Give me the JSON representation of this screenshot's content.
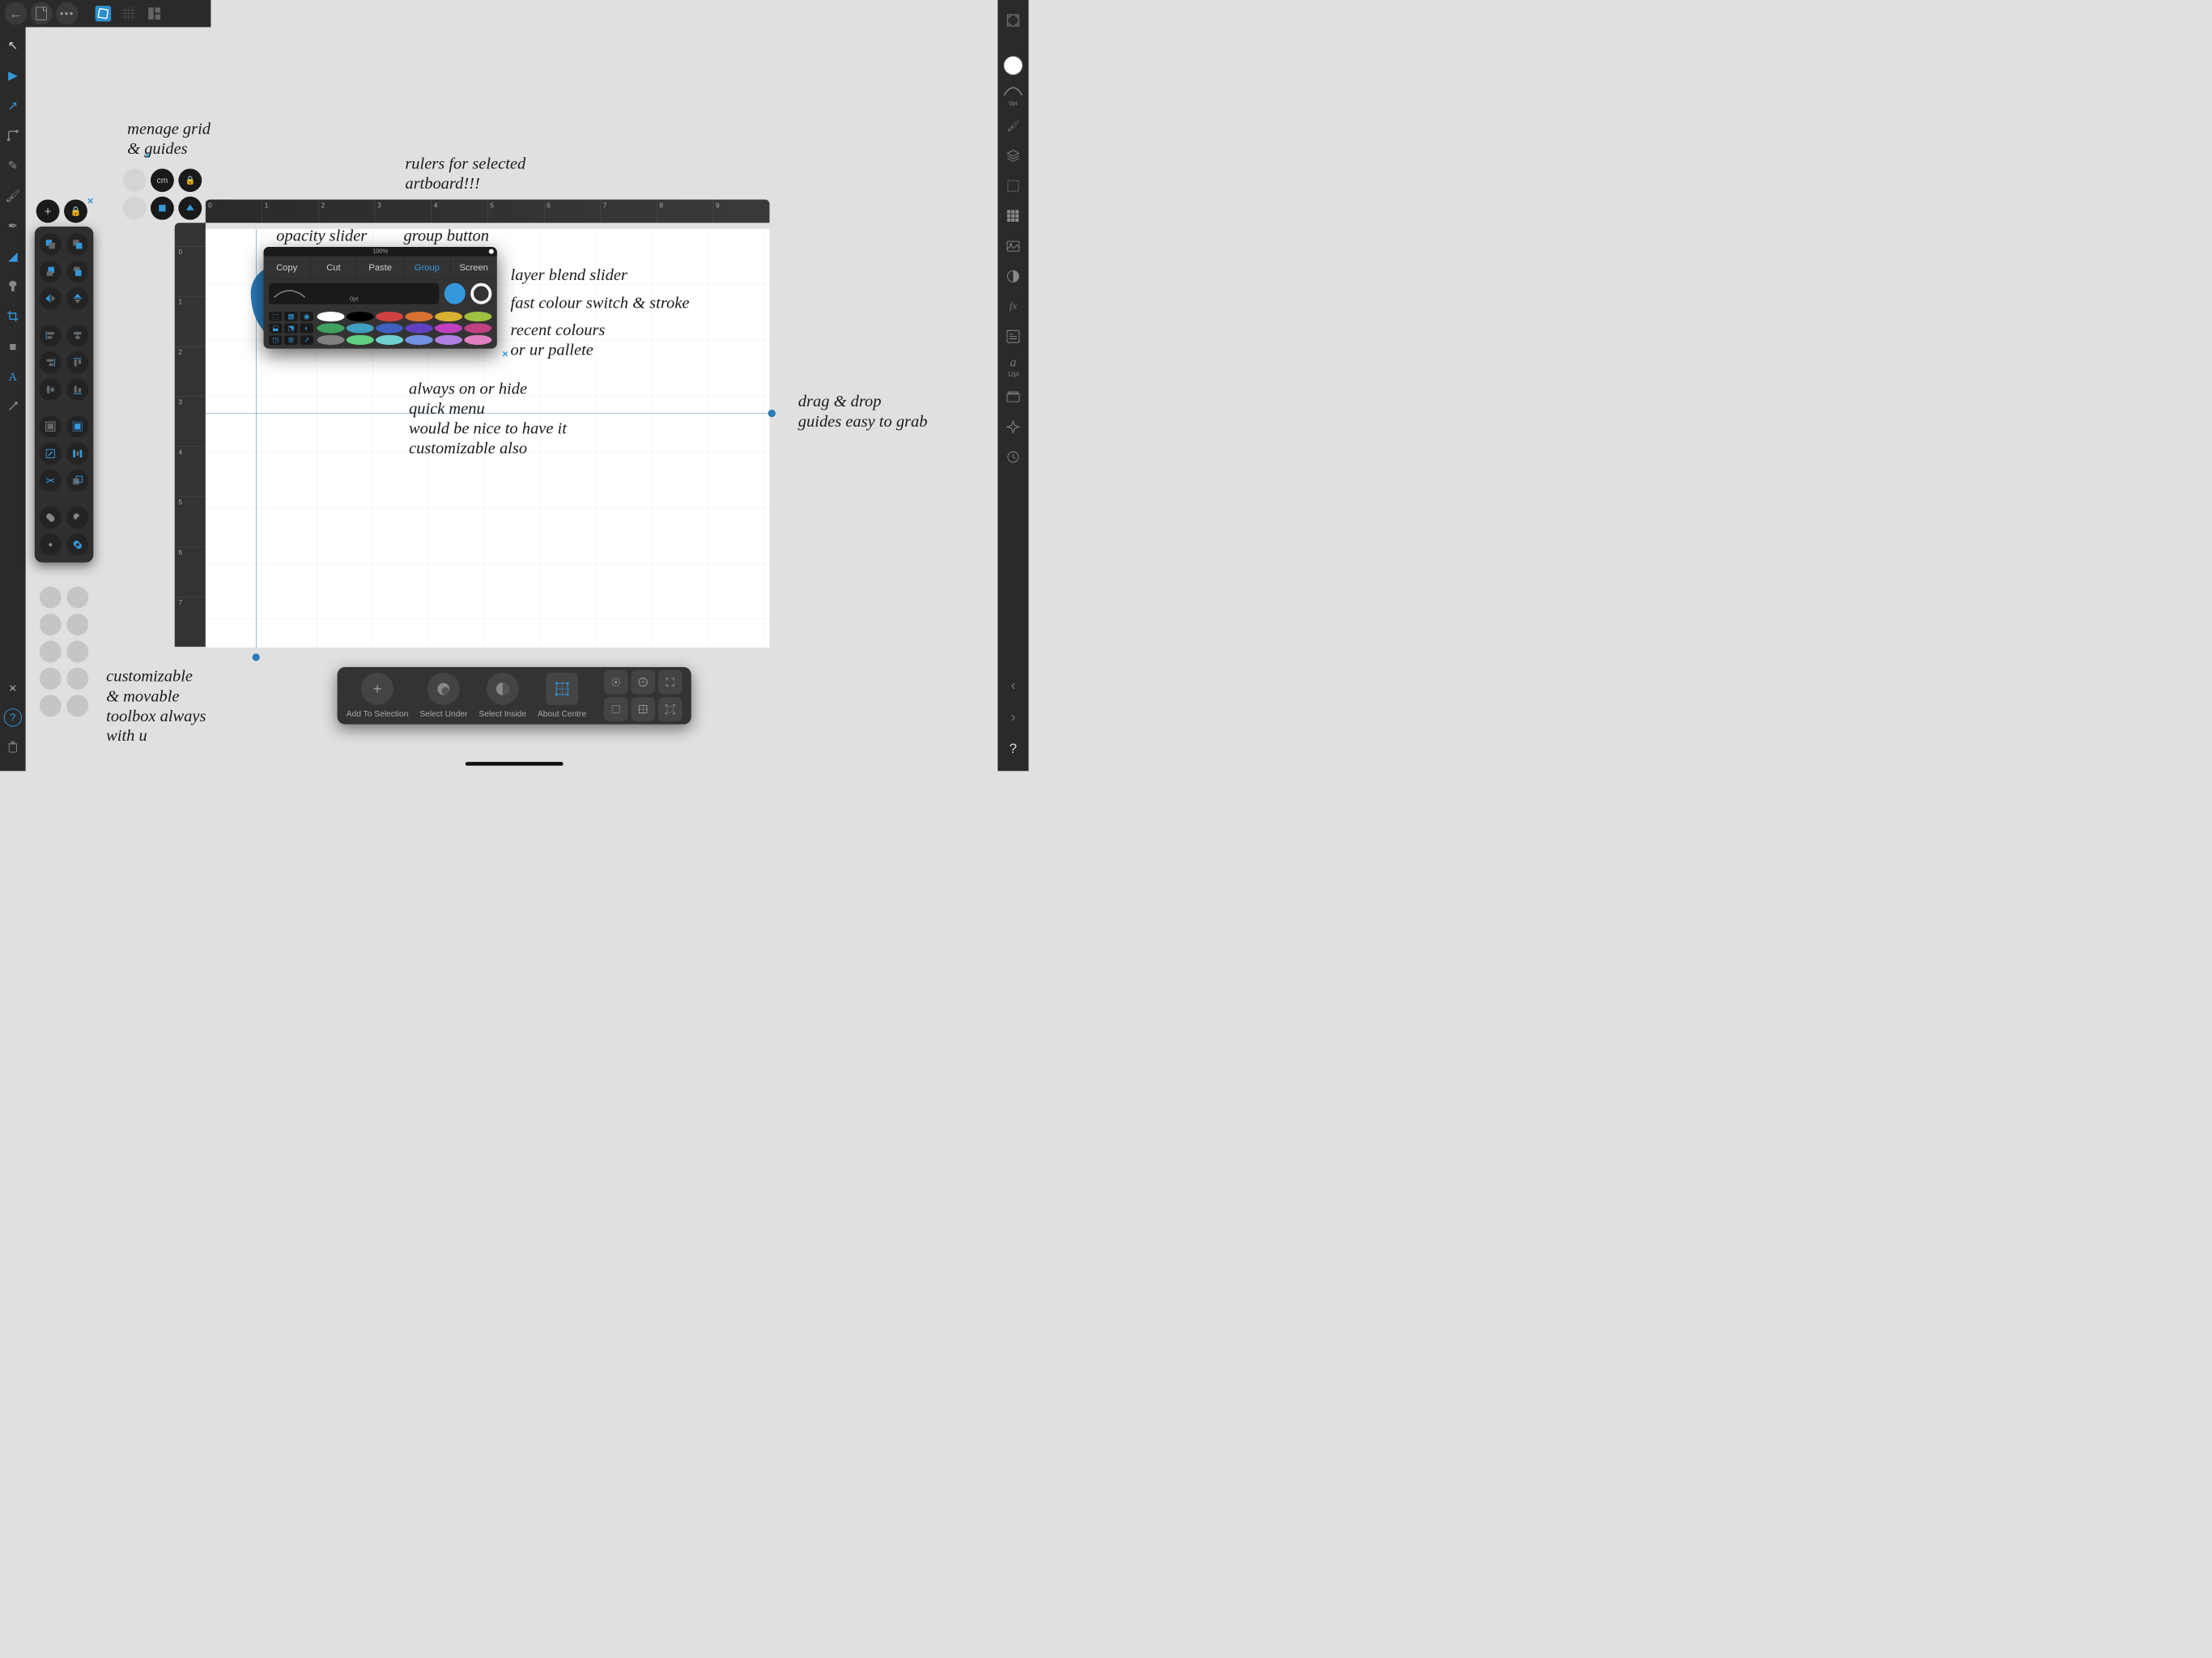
{
  "top": {
    "back": "←"
  },
  "left_tools": [
    {
      "name": "move-tool",
      "icon": "↖",
      "active": false,
      "white": true
    },
    {
      "name": "node-tool",
      "icon": "▶",
      "active": true
    },
    {
      "name": "point-transform",
      "icon": "↗",
      "active": true
    },
    {
      "name": "corner-tool",
      "icon": "✎",
      "active": false
    },
    {
      "name": "pencil-tool",
      "icon": "✏",
      "active": false
    },
    {
      "name": "vector-brush",
      "icon": "🖌",
      "active": false
    },
    {
      "name": "picker-tool",
      "icon": "✒",
      "active": false
    },
    {
      "name": "fill-tool",
      "icon": "◢",
      "active": true
    },
    {
      "name": "transparency-tool",
      "icon": "▮",
      "active": false
    },
    {
      "name": "crop-tool",
      "icon": "⧉",
      "active": true
    },
    {
      "name": "shape-tool",
      "icon": "■",
      "active": false
    },
    {
      "name": "text-tool",
      "icon": "A",
      "active": true
    },
    {
      "name": "measure-tool",
      "icon": "╱",
      "active": false
    }
  ],
  "right_panel": {
    "stroke_width": "0pt",
    "font_size": "12pt"
  },
  "grid_mgr": {
    "unit": "cm"
  },
  "quick_menu": {
    "opacity": "100%",
    "buttons": [
      "Copy",
      "Cut",
      "Paste",
      "Group",
      "Screen"
    ],
    "stroke_label": "0pt",
    "palette": [
      "#ffffff",
      "#000000",
      "#d04040",
      "#d87030",
      "#d8b030",
      "#a0c040",
      "#40a060",
      "#40a0c0",
      "#4060c0",
      "#6040c0",
      "#c040c0",
      "#c04080",
      "#808080",
      "#60d080",
      "#70d0d0",
      "#7090e0",
      "#b080e0",
      "#e080c0"
    ]
  },
  "ruler": {
    "h_ticks": [
      "0",
      "1",
      "2",
      "3",
      "4",
      "5",
      "6",
      "7",
      "8",
      "9"
    ],
    "v_ticks": [
      "0",
      "1",
      "2",
      "3",
      "4",
      "5",
      "6",
      "7"
    ]
  },
  "bottom_bar": {
    "items": [
      "Add To Selection",
      "Select Under",
      "Select Inside",
      "About Centre"
    ]
  },
  "notes": {
    "grid": "menage grid\n& guides",
    "rulers": "rulers for selected\nartboard!!!",
    "opacity": "opacity slider",
    "group": "group button",
    "blend": "layer blend slider",
    "fast_color": "fast colour switch & stroke",
    "recent": "recent colours\nor ur pallete",
    "always": "always on or hide\nquick menu\nwould be nice to have it\ncustomizable also",
    "guides": "drag & drop\nguides easy to grab",
    "toolbox": "customizable\n& movable\ntoolbox always\nwith u"
  }
}
